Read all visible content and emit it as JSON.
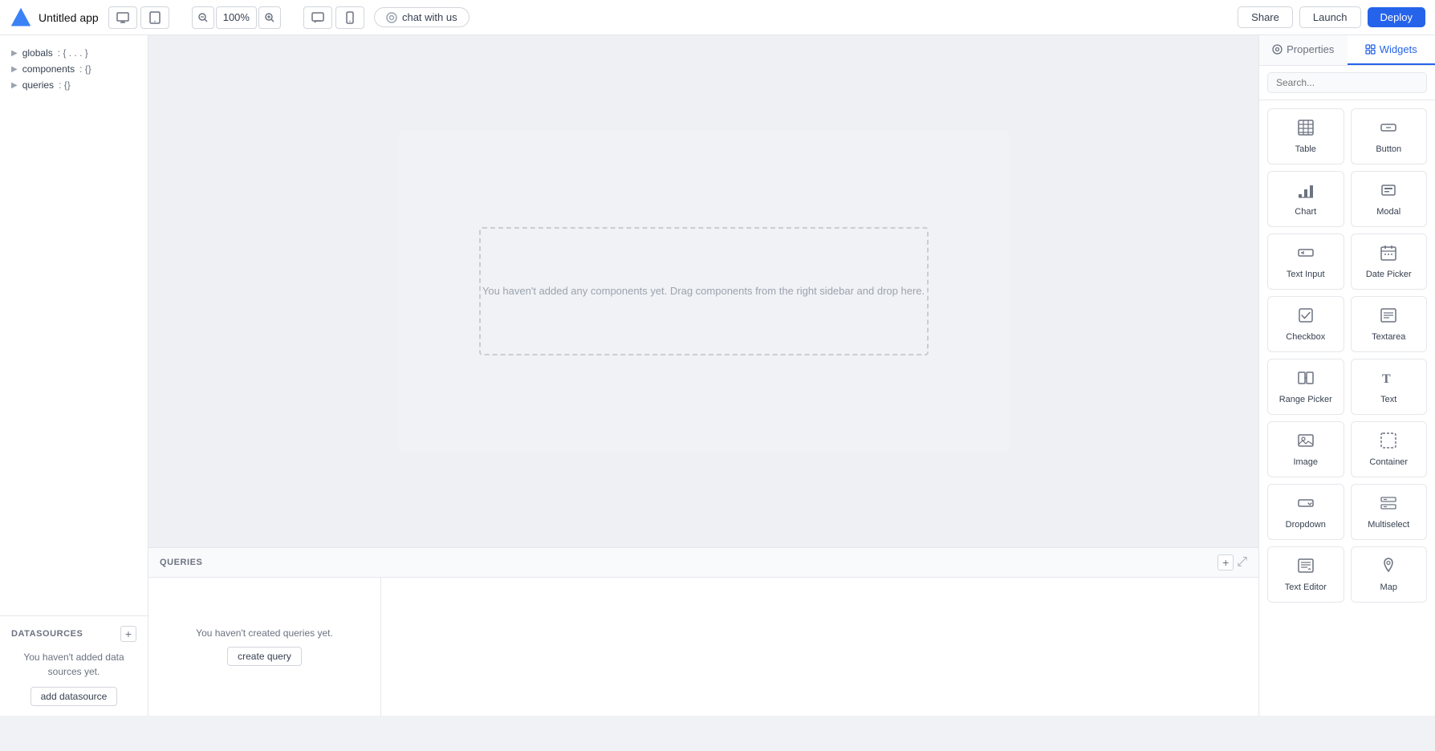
{
  "topbar": {
    "app_title": "Untitled app",
    "zoom_level": "100%",
    "chat_label": "chat with us",
    "share_label": "Share",
    "launch_label": "Launch",
    "deploy_label": "Deploy"
  },
  "left_sidebar": {
    "tree_items": [
      {
        "key": "globals",
        "val": "{ . . . }"
      },
      {
        "key": "components",
        "val": "{}"
      },
      {
        "key": "queries",
        "val": "{}"
      }
    ],
    "datasources_label": "DATASOURCES",
    "add_btn_label": "+",
    "empty_ds_text": "You haven't added data sources yet.",
    "add_ds_btn": "add datasource"
  },
  "canvas": {
    "drop_zone_text": "You haven't added any components yet. Drag components from the right sidebar and drop here."
  },
  "queries_panel": {
    "label": "QUERIES",
    "add_btn": "+",
    "empty_text": "You haven't created queries yet.",
    "create_btn": "create query"
  },
  "right_sidebar": {
    "tabs": [
      {
        "id": "properties",
        "label": "Properties",
        "icon": "settings"
      },
      {
        "id": "widgets",
        "label": "Widgets",
        "icon": "widgets",
        "active": true
      }
    ],
    "search_placeholder": "Search...",
    "widgets": [
      {
        "id": "table",
        "label": "Table",
        "icon": "table"
      },
      {
        "id": "button",
        "label": "Button",
        "icon": "button"
      },
      {
        "id": "chart",
        "label": "Chart",
        "icon": "chart"
      },
      {
        "id": "modal",
        "label": "Modal",
        "icon": "modal"
      },
      {
        "id": "text-input",
        "label": "Text Input",
        "icon": "text-input"
      },
      {
        "id": "date-picker",
        "label": "Date Picker",
        "icon": "date-picker"
      },
      {
        "id": "checkbox",
        "label": "Checkbox",
        "icon": "checkbox"
      },
      {
        "id": "textarea",
        "label": "Textarea",
        "icon": "textarea"
      },
      {
        "id": "range-picker",
        "label": "Range Picker",
        "icon": "range-picker"
      },
      {
        "id": "text",
        "label": "Text",
        "icon": "text"
      },
      {
        "id": "image",
        "label": "Image",
        "icon": "image"
      },
      {
        "id": "container",
        "label": "Container",
        "icon": "container"
      },
      {
        "id": "dropdown",
        "label": "Dropdown",
        "icon": "dropdown"
      },
      {
        "id": "multiselect",
        "label": "Multiselect",
        "icon": "multiselect"
      },
      {
        "id": "text-editor",
        "label": "Text Editor",
        "icon": "text-editor"
      },
      {
        "id": "map",
        "label": "Map",
        "icon": "map"
      }
    ]
  }
}
